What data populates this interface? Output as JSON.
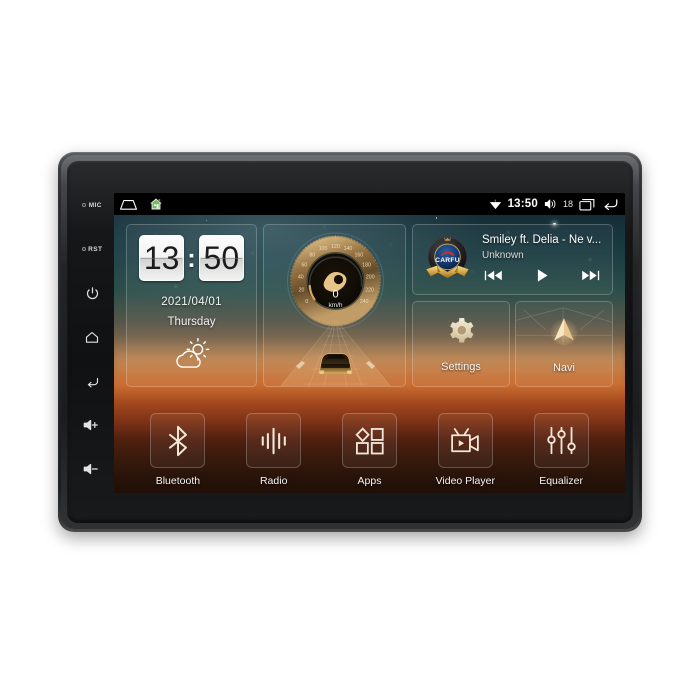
{
  "device": {
    "name": "car-head-unit",
    "side_buttons": [
      {
        "id": "mic",
        "label": "MIC",
        "type": "text-dot"
      },
      {
        "id": "rst",
        "label": "RST",
        "type": "text-dot"
      },
      {
        "id": "power",
        "label": "",
        "icon": "power-icon"
      },
      {
        "id": "home",
        "label": "",
        "icon": "home-icon"
      },
      {
        "id": "back",
        "label": "",
        "icon": "back-arrow-icon"
      },
      {
        "id": "volume-up",
        "label": "+",
        "icon": "volume-up-icon"
      },
      {
        "id": "volume-down",
        "label": "−",
        "icon": "volume-down-icon"
      }
    ]
  },
  "statusbar": {
    "left_icons": [
      {
        "name": "minimize-icon"
      },
      {
        "name": "home-green-icon"
      }
    ],
    "wifi_icon": "wifi-icon",
    "time": "13:50",
    "volume_icon": "volume-icon",
    "volume_level": "18",
    "recents_icon": "recent-apps-icon",
    "back_icon": "back-arrow-icon"
  },
  "clock_widget": {
    "hours": "13",
    "minutes": "50",
    "separator": ":",
    "date": "2021/04/01",
    "weekday": "Thursday",
    "weather_icon": "partly-cloudy-sun-icon"
  },
  "speedometer_widget": {
    "value": "0",
    "unit": "km/h",
    "tick_labels": [
      "0",
      "20",
      "40",
      "60",
      "80",
      "100",
      "120",
      "140",
      "160",
      "180",
      "200",
      "220",
      "240"
    ],
    "min": 0,
    "max": 240,
    "accent_color": "#d8a85c"
  },
  "music_widget": {
    "album_art": "carfu-logo-badge",
    "album_brand": "CARFU",
    "track_title": "Smiley ft. Delia - Ne v...",
    "artist": "Unknown",
    "controls": [
      {
        "name": "previous-track-button",
        "icon": "skip-previous-icon"
      },
      {
        "name": "play-button",
        "icon": "play-icon"
      },
      {
        "name": "next-track-button",
        "icon": "skip-next-icon"
      }
    ]
  },
  "tiles": [
    {
      "name": "settings-tile",
      "label": "Settings",
      "icon": "gear-icon"
    },
    {
      "name": "navi-tile",
      "label": "Navi",
      "icon": "navigation-arrow-icon"
    }
  ],
  "dock": {
    "items": [
      {
        "name": "bluetooth",
        "label": "Bluetooth",
        "icon": "bluetooth-icon"
      },
      {
        "name": "radio",
        "label": "Radio",
        "icon": "radio-waves-icon"
      },
      {
        "name": "apps",
        "label": "Apps",
        "icon": "apps-grid-icon"
      },
      {
        "name": "video-player",
        "label": "Video Player",
        "icon": "video-camera-icon"
      },
      {
        "name": "equalizer",
        "label": "Equalizer",
        "icon": "equalizer-sliders-icon"
      }
    ]
  },
  "colors": {
    "accent_gold": "#d8a85c",
    "screen_dark": "#0a0c10",
    "bezel": "#1b1c1e",
    "text_light": "#f4f4f4",
    "home_icon_green": "#64b45a"
  }
}
